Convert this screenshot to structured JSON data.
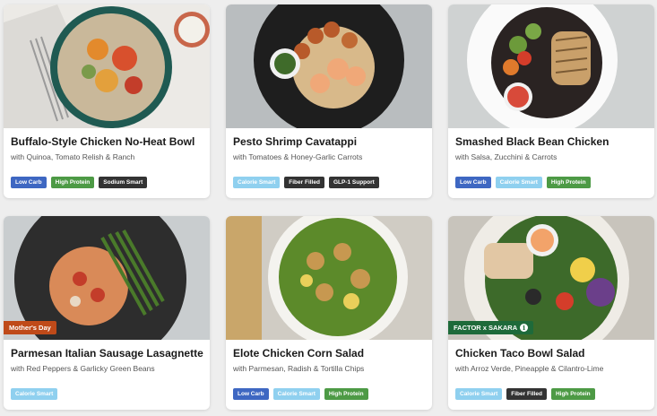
{
  "meals": [
    {
      "title": "Buffalo-Style Chicken No-Heat Bowl",
      "subtitle": "with Quinoa, Tomato Relish & Ranch",
      "tags": [
        "Low Carb",
        "High Protein",
        "Sodium Smart"
      ]
    },
    {
      "title": "Pesto Shrimp Cavatappi",
      "subtitle": "with Tomatoes & Honey-Garlic Carrots",
      "tags": [
        "Calorie Smart",
        "Fiber Filled",
        "GLP-1 Support"
      ]
    },
    {
      "title": "Smashed Black Bean Chicken",
      "subtitle": "with Salsa, Zucchini & Carrots",
      "tags": [
        "Low Carb",
        "Calorie Smart",
        "High Protein"
      ]
    },
    {
      "title": "Parmesan Italian Sausage Lasagnette",
      "subtitle": "with Red Peppers & Garlicky Green Beans",
      "tags": [
        "Calorie Smart"
      ],
      "ribbon": "Mother's Day"
    },
    {
      "title": "Elote Chicken Corn Salad",
      "subtitle": "with Parmesan, Radish & Tortilla Chips",
      "tags": [
        "Low Carb",
        "Calorie Smart",
        "High Protein"
      ]
    },
    {
      "title": "Chicken Taco Bowl Salad",
      "subtitle": "with Arroz Verde, Pineapple & Cilantro-Lime",
      "tags": [
        "Calorie Smart",
        "Fiber Filled",
        "High Protein"
      ],
      "ribbon": "FACTOR x SAKARA"
    }
  ],
  "tag_colors": {
    "Low Carb": "#3e67c2",
    "High Protein": "#4d9a45",
    "Sodium Smart": "#333333",
    "Calorie Smart": "#8fd0ef",
    "Fiber Filled": "#333333",
    "GLP-1 Support": "#333333"
  },
  "icons": {
    "ribbon_info": "info-icon"
  }
}
